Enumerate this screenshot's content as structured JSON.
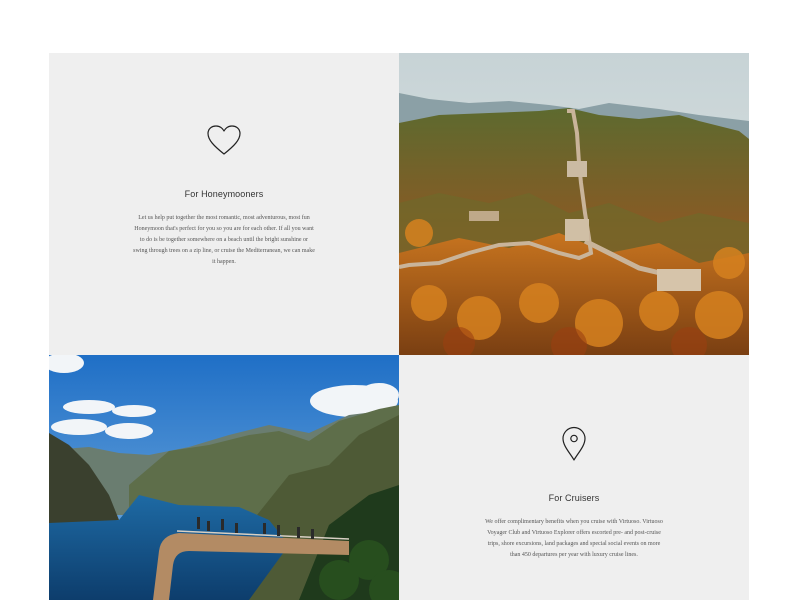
{
  "honeymoon": {
    "icon": "heart-icon",
    "title": "For Honeymooners",
    "description": "Let us help put together the most romantic, most adventurous, most fun Honeymoon that's perfect for you so you are for each other. If all you want to do is be together somewhere on a beach until the bright sunshine or swing through trees on a zip line, or cruise the Mediterranean, we can make it happen."
  },
  "cruisers": {
    "icon": "map-pin-icon",
    "title": "For Cruisers",
    "description": "We offer complimentary benefits when you cruise with Virtuoso. Virtuoso Voyager Club and Virtuoso Explorer offers escorted pre- and post-cruise trips, shore excursions, land packages and special social events on more than 450 departures per year with luxury cruise lines."
  },
  "images": {
    "great_wall": "great-wall-autumn-photo",
    "fjord": "fjord-viewpoint-photo"
  },
  "colors": {
    "card_bg": "#efefef",
    "text": "#333333"
  }
}
